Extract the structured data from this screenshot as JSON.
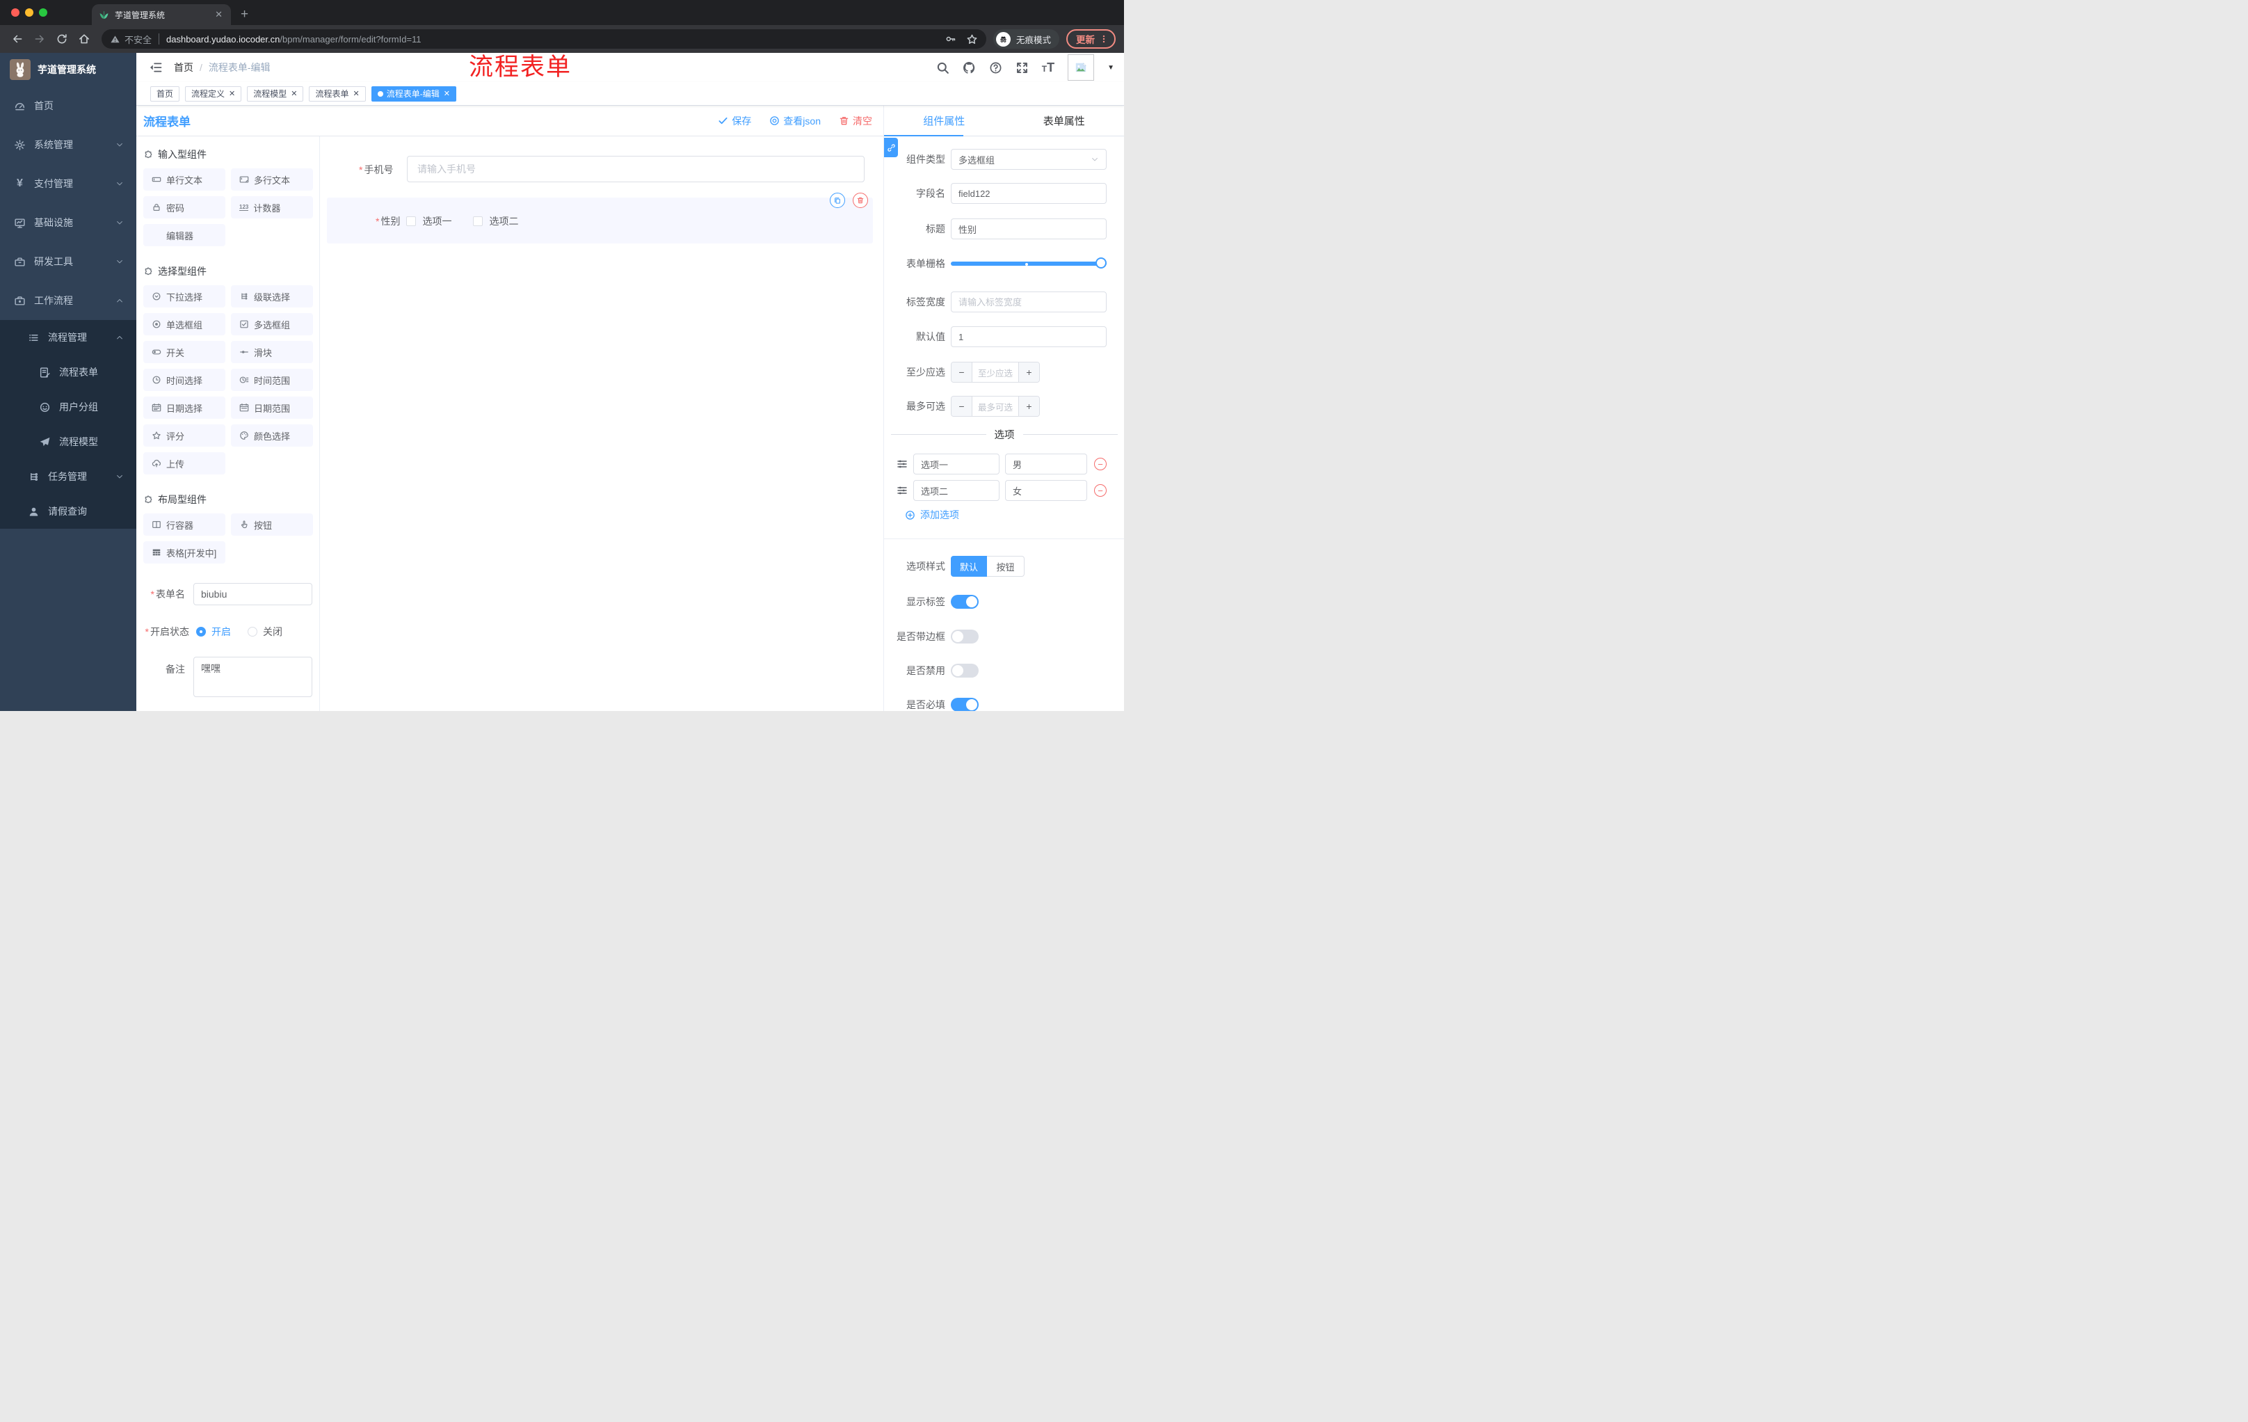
{
  "colors": {
    "accent": "#409EFF",
    "danger": "#F56C6C",
    "annotation_red": "#F22222",
    "sidebar_bg": "#304156",
    "sidebar_submenu_bg": "#1F2D3D",
    "active_tab_bg": "#409EFF"
  },
  "browser": {
    "tab_title": "芋道管理系统",
    "security_label": "不安全",
    "url_domain": "dashboard.yudao.iocoder.cn",
    "url_path": "/bpm/manager/form/edit?formId=11",
    "incognito_label": "无痕模式",
    "update_label": "更新"
  },
  "topbar": {
    "breadcrumb_home": "首页",
    "breadcrumb_current": "流程表单-编辑",
    "annotation": "流程表单"
  },
  "tags": {
    "items": [
      {
        "label": "首页"
      },
      {
        "label": "流程定义"
      },
      {
        "label": "流程模型"
      },
      {
        "label": "流程表单"
      },
      {
        "label": "流程表单-编辑"
      }
    ]
  },
  "sidebar": {
    "logo_title": "芋道管理系统",
    "items": [
      {
        "label": "首页"
      },
      {
        "label": "系统管理"
      },
      {
        "label": "支付管理"
      },
      {
        "label": "基础设施"
      },
      {
        "label": "研发工具"
      },
      {
        "label": "工作流程"
      },
      {
        "label": "流程管理"
      },
      {
        "label": "流程表单"
      },
      {
        "label": "用户分组"
      },
      {
        "label": "流程模型"
      },
      {
        "label": "任务管理"
      },
      {
        "label": "请假查询"
      }
    ]
  },
  "designer": {
    "title": "流程表单",
    "save": "保存",
    "view_json": "查看json",
    "clear": "清空",
    "groups": {
      "input": {
        "title": "输入型组件",
        "items": [
          "单行文本",
          "多行文本",
          "密码",
          "计数器",
          "编辑器"
        ]
      },
      "select": {
        "title": "选择型组件",
        "items": [
          "下拉选择",
          "级联选择",
          "单选框组",
          "多选框组",
          "开关",
          "滑块",
          "时间选择",
          "时间范围",
          "日期选择",
          "日期范围",
          "评分",
          "颜色选择",
          "上传"
        ]
      },
      "layout": {
        "title": "布局型组件",
        "items": [
          "行容器",
          "按钮",
          "表格[开发中]"
        ]
      }
    },
    "meta": {
      "name_label": "表单名",
      "name_value": "biubiu",
      "status_label": "开启状态",
      "status_on": "开启",
      "status_off": "关闭",
      "remark_label": "备注",
      "remark_value": "嘿嘿"
    },
    "canvas": {
      "phone_label": "手机号",
      "phone_placeholder": "请输入手机号",
      "gender_label": "性别",
      "gender_options": [
        "选项一",
        "选项二"
      ]
    }
  },
  "props": {
    "tab_component": "组件属性",
    "tab_form": "表单属性",
    "component_type_label": "组件类型",
    "component_type_value": "多选框组",
    "field_name_label": "字段名",
    "field_name_value": "field122",
    "title_label": "标题",
    "title_value": "性别",
    "grid_label": "表单栅格",
    "label_width_label": "标签宽度",
    "label_width_placeholder": "请输入标签宽度",
    "default_label": "默认值",
    "default_value": "1",
    "min_label": "至少应选",
    "min_placeholder": "至少应选",
    "max_label": "最多可选",
    "max_placeholder": "最多可选",
    "options_title": "选项",
    "options": [
      {
        "label": "选项一",
        "value": "男"
      },
      {
        "label": "选项二",
        "value": "女"
      }
    ],
    "add_option": "添加选项",
    "style_label": "选项样式",
    "style_default": "默认",
    "style_button": "按钮",
    "switches": [
      {
        "label": "显示标签",
        "on": true
      },
      {
        "label": "是否带边框",
        "on": false
      },
      {
        "label": "是否禁用",
        "on": false
      },
      {
        "label": "是否必填",
        "on": true
      }
    ]
  }
}
